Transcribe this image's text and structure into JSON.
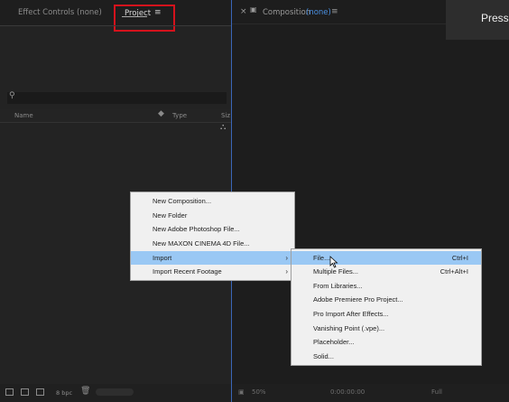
{
  "left_panel": {
    "tab_effect_controls": "Effect Controls (none)",
    "tab_project": "Project",
    "tab_menu_glyph": "≡",
    "columns": {
      "name": "Name",
      "type": "Type",
      "size": "Siz"
    },
    "bit_depth": "8 bpc"
  },
  "comp_panel": {
    "close_glyph": "×",
    "lock_glyph": "🔒",
    "title": "Composition",
    "title_value": "(none)",
    "menu_glyph": "≡",
    "zoom": "50%",
    "timecode": "0:00:00:00",
    "resolution": "Full"
  },
  "overlay": {
    "text": "Press"
  },
  "context_menu": {
    "items": [
      {
        "label": "New Composition..."
      },
      {
        "label": "New Folder"
      },
      {
        "label": "New Adobe Photoshop File..."
      },
      {
        "label": "New MAXON CINEMA 4D File..."
      },
      {
        "label": "Import",
        "submenu": true,
        "highlighted": true
      },
      {
        "label": "Import Recent Footage",
        "submenu": true
      }
    ]
  },
  "import_submenu": {
    "items": [
      {
        "label": "File...",
        "shortcut": "Ctrl+I",
        "highlighted": true
      },
      {
        "label": "Multiple Files...",
        "shortcut": "Ctrl+Alt+I"
      },
      {
        "label": "From Libraries...",
        "shortcut": ""
      },
      {
        "label": "Adobe Premiere Pro Project...",
        "shortcut": ""
      },
      {
        "label": "Pro Import After Effects...",
        "shortcut": ""
      },
      {
        "label": "Vanishing Point (.vpe)...",
        "shortcut": ""
      },
      {
        "label": "Placeholder...",
        "shortcut": ""
      },
      {
        "label": "Solid...",
        "shortcut": ""
      }
    ]
  },
  "colors": {
    "accent_blue": "#4a8fe0",
    "highlight": "#9ac8f4",
    "callout_red": "#d4121c"
  }
}
